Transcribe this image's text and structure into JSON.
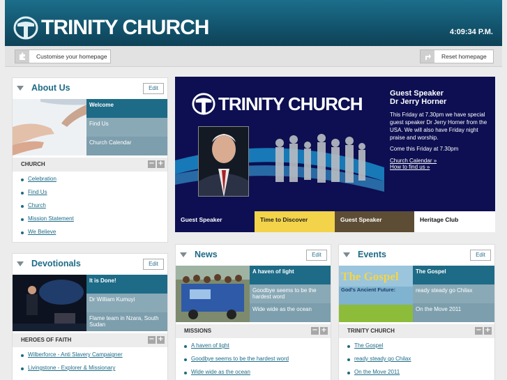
{
  "header": {
    "logo_text": "TRINITY CHURCH",
    "clock": "4:09:34 P.M."
  },
  "toolbar": {
    "customise_label": "Customise your homepage",
    "reset_label": "Reset homepage"
  },
  "about": {
    "title": "About Us",
    "edit_label": "Edit",
    "menu": [
      "Welcome",
      "Find Us",
      "Church Calendar"
    ],
    "sub_title": "CHURCH",
    "links": [
      "Celebration",
      "Find Us",
      "Church",
      "Mission Statement",
      "We Believe"
    ]
  },
  "devotionals": {
    "title": "Devotionals",
    "edit_label": "Edit",
    "menu": [
      "It is Done!",
      "Dr William Kumuyi",
      "Flame team in Nzara, South Sudan"
    ],
    "sub_title": "HEROES OF FAITH",
    "links": [
      "Wilberforce - Anti Slavery Campaigner",
      "Livingstone - Explorer & Missionary"
    ]
  },
  "hero": {
    "logo_text": "TRINITY CHURCH",
    "heading": "Guest Speaker\nDr Jerry Horner",
    "para1": "This Friday at 7.30pm we have special guest speaker Dr Jerry Horner from the USA. We will also have Friday night praise and worship.",
    "para2": "Come this Friday at 7.30pm",
    "link1": "Church Calendar »",
    "link2": "How to find us »",
    "tabs": [
      "Guest Speaker",
      "Time to Discover",
      "Guest Speaker",
      "Heritage Club"
    ]
  },
  "news": {
    "title": "News",
    "edit_label": "Edit",
    "menu": [
      "A haven of light",
      "Goodbye seems to be the hardest word",
      "Wide wide as the ocean"
    ],
    "sub_title": "MISSIONS",
    "links": [
      "A haven of light",
      "Goodbye seems to be the hardest word",
      "Wide wide as the ocean"
    ]
  },
  "events": {
    "title": "Events",
    "edit_label": "Edit",
    "banner_title": "The Gospel",
    "banner_sub": "God's Ancient Future:",
    "menu": [
      "The Gospel",
      "ready steady go Chilax",
      "On the Move 2011"
    ],
    "sub_title": "TRINITY CHURCH",
    "links": [
      "The Gospel",
      "ready steady go Chilax",
      "On the Move 2011"
    ]
  },
  "colors": {
    "brand_teal": "#1d6b87",
    "hero_navy": "#0d0f52",
    "tab_yellow": "#f3d34a",
    "tab_brown": "#5d4d34"
  }
}
